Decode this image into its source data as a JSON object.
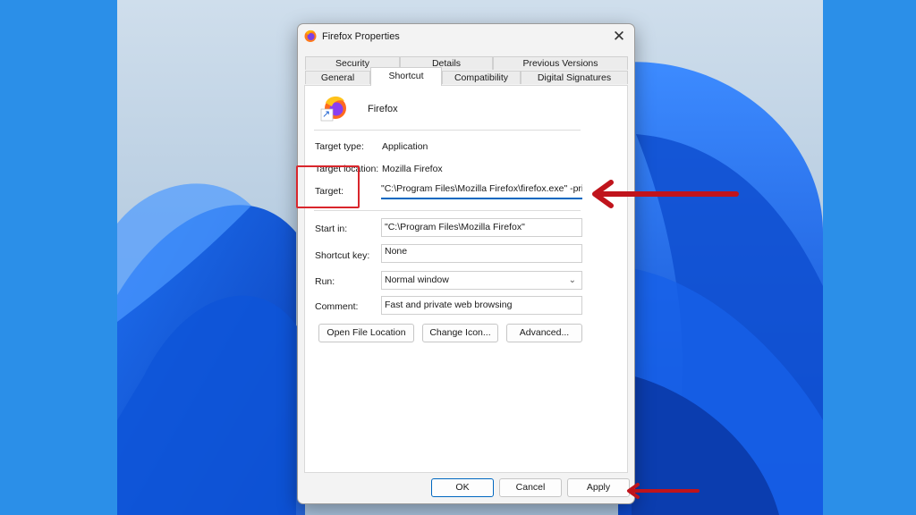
{
  "dialog": {
    "title": "Firefox Properties",
    "close_glyph": "✕",
    "tabs_row1": [
      "Security",
      "Details",
      "Previous Versions"
    ],
    "tabs_row2": [
      "General",
      "Shortcut",
      "Compatibility",
      "Digital Signatures"
    ],
    "active_tab": "Shortcut"
  },
  "shortcut": {
    "app_name": "Firefox",
    "target_type_label": "Target type:",
    "target_type_value": "Application",
    "target_location_label": "Target location:",
    "target_location_value": "Mozilla Firefox",
    "target_label": "Target:",
    "target_value": "\"C:\\Program Files\\Mozilla Firefox\\firefox.exe\" -private-window",
    "start_in_label": "Start in:",
    "start_in_value": "\"C:\\Program Files\\Mozilla Firefox\"",
    "shortcut_key_label": "Shortcut key:",
    "shortcut_key_value": "None",
    "run_label": "Run:",
    "run_value": "Normal window",
    "comment_label": "Comment:",
    "comment_value": "Fast and private web browsing",
    "open_file_location_label": "Open File Location",
    "change_icon_label": "Change Icon...",
    "advanced_label": "Advanced..."
  },
  "footer": {
    "ok_label": "OK",
    "cancel_label": "Cancel",
    "apply_label": "Apply"
  },
  "annotation": {
    "highlight_color": "#d9262c",
    "arrow_color": "#c0141c"
  },
  "icons": {
    "title_icon": "firefox-icon",
    "app_icon": "firefox-icon",
    "shortcut_overlay": "shortcut-arrow-icon",
    "close": "close-icon",
    "dropdown": "chevron-down-icon"
  }
}
